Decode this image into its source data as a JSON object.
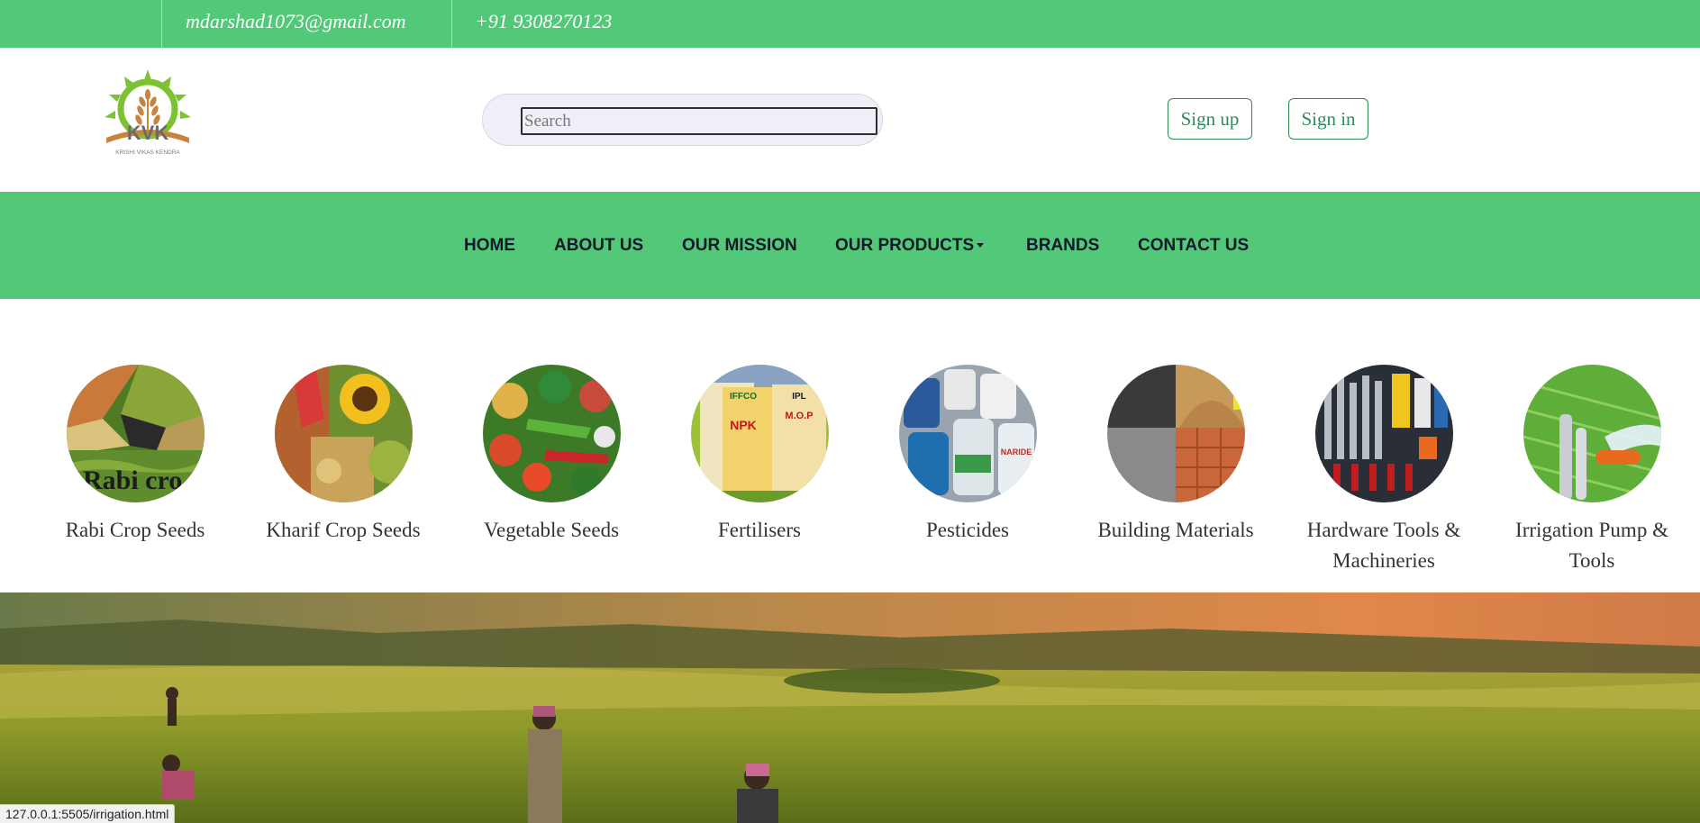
{
  "topbar": {
    "email": "mdarshad1073@gmail.com",
    "phone": "+91 9308270123"
  },
  "header": {
    "logo": {
      "initials": "KVK",
      "tagline": "KRISHI VIKAS KENDRA"
    },
    "search": {
      "placeholder": "Search",
      "value": ""
    },
    "signup_label": "Sign up",
    "signin_label": "Sign in"
  },
  "nav": {
    "items": [
      {
        "label": "HOME"
      },
      {
        "label": "ABOUT US"
      },
      {
        "label": "OUR MISSION"
      },
      {
        "label": "OUR PRODUCTS",
        "has_dropdown": true
      },
      {
        "label": "BRANDS"
      },
      {
        "label": "CONTACT US"
      }
    ]
  },
  "categories": [
    {
      "label": "Rabi Crop Seeds",
      "image_text": "Rabi  cro"
    },
    {
      "label": "Kharif Crop Seeds"
    },
    {
      "label": "Vegetable Seeds"
    },
    {
      "label": "Fertilisers",
      "image_text": [
        "IFFCO",
        "NPK",
        "IPL",
        "M.O.P"
      ]
    },
    {
      "label": "Pesticides",
      "image_text": "NARIDE"
    },
    {
      "label": "Building Materials"
    },
    {
      "label": "Hardware Tools & Machineries"
    },
    {
      "label": "Irrigation Pump & Tools"
    }
  ],
  "hero": {
    "image": "farm-field-workers-photo"
  },
  "status_bar": {
    "url": "127.0.0.1:5505/irrigation.html"
  },
  "colors": {
    "topbar_bg": "#52c878",
    "nav_bg": "#52c878",
    "button_border": "#2e8b57",
    "nav_text": "#0e1a2b"
  }
}
